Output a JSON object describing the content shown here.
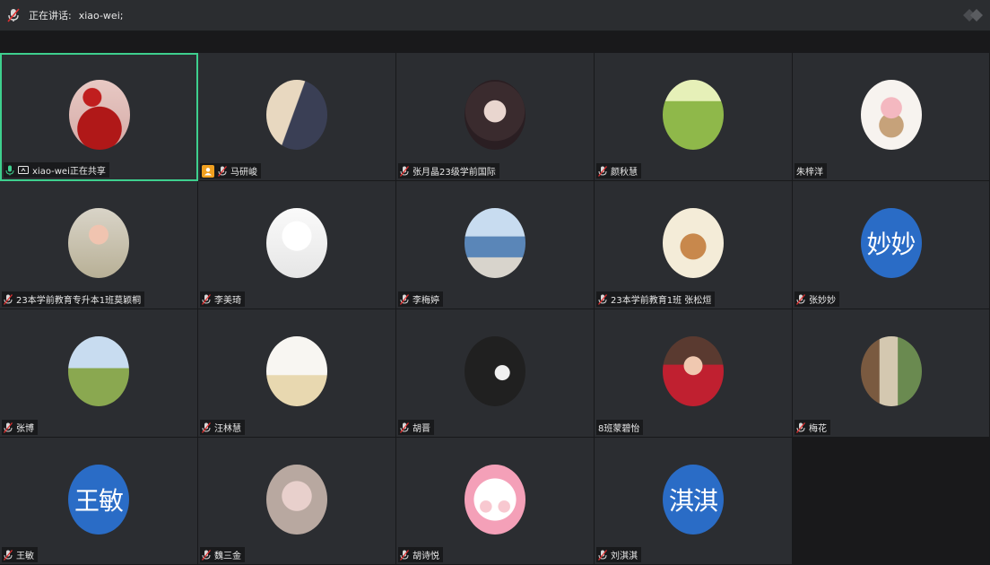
{
  "header": {
    "speaking_label": "正在讲话:",
    "speaking_name": "xiao-wei;"
  },
  "participants": [
    {
      "name": "xiao-wei正在共享",
      "avatar": "photo",
      "active": true
    },
    {
      "name": "马研峻",
      "avatar": "photo",
      "badge": true
    },
    {
      "name": "张月晶23级学前国际",
      "avatar": "photo"
    },
    {
      "name": "颜秋慧",
      "avatar": "photo"
    },
    {
      "name": "朱梓洋",
      "avatar": "photo",
      "no_mic": true
    },
    {
      "name": "23本学前教育专升本1班莫颖桐",
      "avatar": "photo"
    },
    {
      "name": "李美琦",
      "avatar": "photo"
    },
    {
      "name": "李梅婷",
      "avatar": "photo"
    },
    {
      "name": "23本学前教育1班 张松烜",
      "avatar": "photo"
    },
    {
      "name": "张妙妙",
      "avatar": "text",
      "avatar_text": "妙妙"
    },
    {
      "name": "张博",
      "avatar": "photo"
    },
    {
      "name": "汪林慧",
      "avatar": "photo"
    },
    {
      "name": "胡晋",
      "avatar": "photo"
    },
    {
      "name": "8班蒙碧怡",
      "avatar": "photo",
      "no_mic": true
    },
    {
      "name": "梅花",
      "avatar": "photo"
    },
    {
      "name": "王敏",
      "avatar": "text",
      "avatar_text": "王敏"
    },
    {
      "name": "魏三金",
      "avatar": "photo"
    },
    {
      "name": "胡诗悦",
      "avatar": "photo"
    },
    {
      "name": "刘淇淇",
      "avatar": "text",
      "avatar_text": "淇淇"
    }
  ],
  "colors": {
    "accent": "#3ecf8e",
    "text_avatar": "#2a6cc6",
    "badge": "#f0a020"
  }
}
